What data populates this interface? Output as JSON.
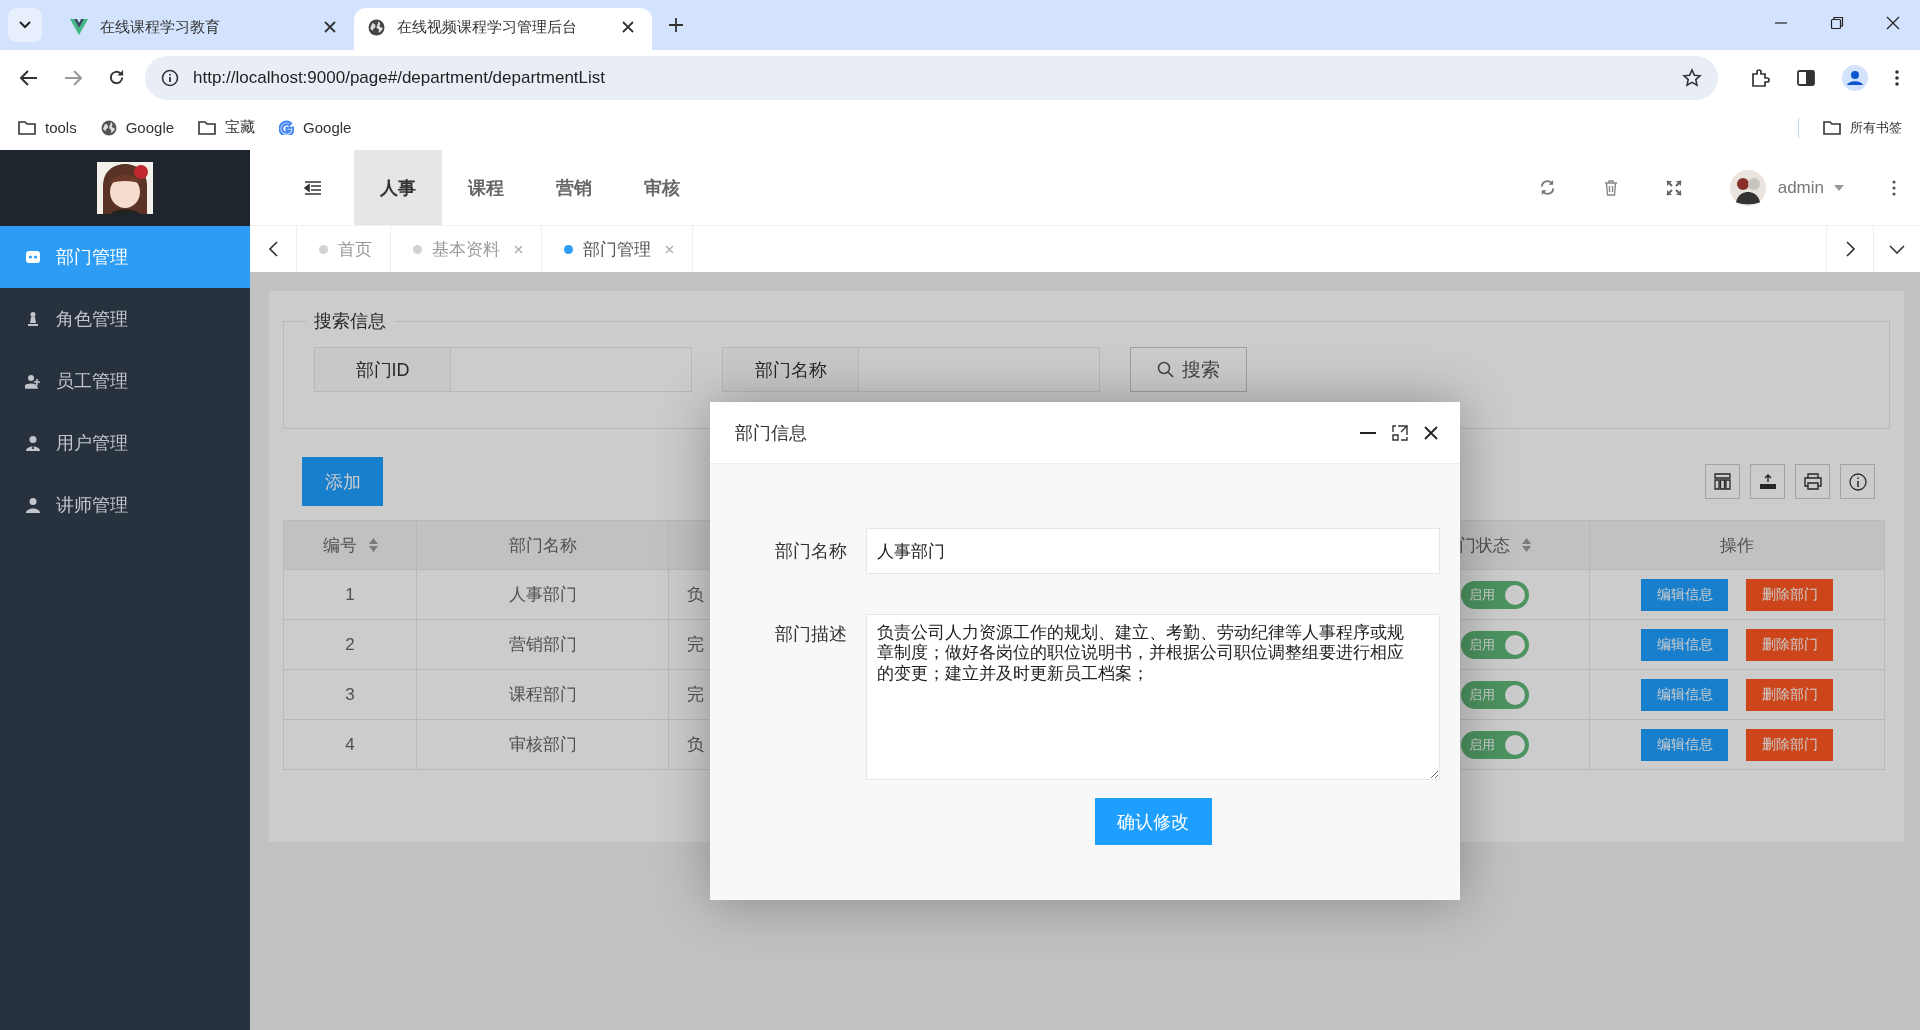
{
  "browser": {
    "tabs": [
      {
        "title": "在线课程学习教育",
        "kind": "vue",
        "selected": false
      },
      {
        "title": "在线视频课程学习管理后台",
        "kind": "globe",
        "selected": true
      }
    ],
    "url": "http://localhost:9000/page#/department/departmentList",
    "bookmarks": [
      {
        "label": "tools",
        "kind": "folder"
      },
      {
        "label": "Google",
        "kind": "globe"
      },
      {
        "label": "宝藏",
        "kind": "folder"
      },
      {
        "label": "Google",
        "kind": "google"
      }
    ],
    "all_bookmarks": "所有书签"
  },
  "sidebar": {
    "items": [
      {
        "label": "部门管理",
        "kind": "card",
        "selected": true
      },
      {
        "label": "角色管理",
        "kind": "pawn",
        "selected": false
      },
      {
        "label": "员工管理",
        "kind": "useradd",
        "selected": false
      },
      {
        "label": "用户管理",
        "kind": "staff",
        "selected": false
      },
      {
        "label": "讲师管理",
        "kind": "user",
        "selected": false
      }
    ]
  },
  "top_nav": {
    "items": [
      {
        "label": "人事",
        "selected": true
      },
      {
        "label": "课程",
        "selected": false
      },
      {
        "label": "营销",
        "selected": false
      },
      {
        "label": "审核",
        "selected": false
      }
    ]
  },
  "user": {
    "name": "admin"
  },
  "page_tabs": [
    {
      "label": "首页",
      "selected": false,
      "closable": false
    },
    {
      "label": "基本资料",
      "selected": false,
      "closable": true
    },
    {
      "label": "部门管理",
      "selected": true,
      "closable": true
    }
  ],
  "search": {
    "title": "搜索信息",
    "fields": [
      {
        "label": "部门ID"
      },
      {
        "label": "部门名称"
      }
    ],
    "button": "搜索"
  },
  "add_button": "添加",
  "table": {
    "columns": [
      {
        "label": "编号",
        "sortable": true
      },
      {
        "label": "部门名称",
        "sortable": false
      },
      {
        "label": "门状态",
        "sortable": true
      },
      {
        "label": "操作",
        "sortable": false
      }
    ],
    "rows": [
      {
        "id": "1",
        "name": "人事部门",
        "column_3": "负",
        "status": {
          "label": "启用",
          "on": true
        },
        "actions": [
          "编辑信息",
          "删除部门"
        ]
      },
      {
        "id": "2",
        "name": "营销部门",
        "column_3": "完",
        "status": {
          "label": "启用",
          "on": true
        },
        "actions": [
          "编辑信息",
          "删除部门"
        ]
      },
      {
        "id": "3",
        "name": "课程部门",
        "column_3": "完",
        "status": {
          "label": "启用",
          "on": true
        },
        "actions": [
          "编辑信息",
          "删除部门"
        ]
      },
      {
        "id": "4",
        "name": "审核部门",
        "column_3": "负",
        "status": {
          "label": "启用",
          "on": true
        },
        "actions": [
          "编辑信息",
          "删除部门"
        ]
      }
    ]
  },
  "dialog": {
    "title": "部门信息",
    "fields": [
      {
        "label": "部门名称",
        "kind": "input",
        "value": "人事部门"
      },
      {
        "label": "部门描述",
        "kind": "textarea",
        "value": "负责公司人力资源工作的规划、建立、考勤、劳动纪律等人事程序或规章制度；做好各岗位的职位说明书，并根据公司职位调整组要进行相应的变更；建立并及时更新员工档案；"
      }
    ],
    "button": "确认修改"
  }
}
